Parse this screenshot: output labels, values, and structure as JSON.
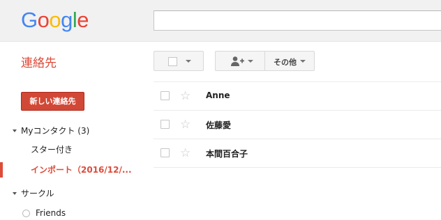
{
  "logo": {
    "letters": [
      "G",
      "o",
      "o",
      "g",
      "l",
      "e"
    ],
    "colors": [
      "#4285f4",
      "#ea4335",
      "#fbbc05",
      "#4285f4",
      "#34a853",
      "#ea4335"
    ]
  },
  "search": {
    "value": "",
    "placeholder": ""
  },
  "app_title": "連絡先",
  "toolbar": {
    "more_label": "その他"
  },
  "sidebar": {
    "new_contact_label": "新しい連絡先",
    "my_contacts_label": "Myコンタクト (3)",
    "starred_label": "スター付き",
    "import_label": "インポート（2016/12/...",
    "circles_label": "サークル",
    "friends_label": "Friends"
  },
  "contacts": [
    {
      "name": "Anne",
      "starred": false
    },
    {
      "name": "佐藤愛",
      "starred": false
    },
    {
      "name": "本間百合子",
      "starred": false
    }
  ],
  "colors": {
    "accent": "#dd4b39",
    "new_button": "#d14836"
  }
}
